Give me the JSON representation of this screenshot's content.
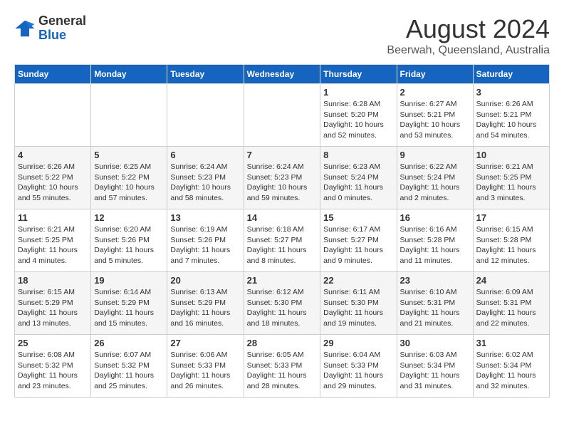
{
  "logo": {
    "general": "General",
    "blue": "Blue"
  },
  "title": "August 2024",
  "subtitle": "Beerwah, Queensland, Australia",
  "days_of_week": [
    "Sunday",
    "Monday",
    "Tuesday",
    "Wednesday",
    "Thursday",
    "Friday",
    "Saturday"
  ],
  "weeks": [
    [
      {
        "day": "",
        "info": ""
      },
      {
        "day": "",
        "info": ""
      },
      {
        "day": "",
        "info": ""
      },
      {
        "day": "",
        "info": ""
      },
      {
        "day": "1",
        "info": "Sunrise: 6:28 AM\nSunset: 5:20 PM\nDaylight: 10 hours and 52 minutes."
      },
      {
        "day": "2",
        "info": "Sunrise: 6:27 AM\nSunset: 5:21 PM\nDaylight: 10 hours and 53 minutes."
      },
      {
        "day": "3",
        "info": "Sunrise: 6:26 AM\nSunset: 5:21 PM\nDaylight: 10 hours and 54 minutes."
      }
    ],
    [
      {
        "day": "4",
        "info": "Sunrise: 6:26 AM\nSunset: 5:22 PM\nDaylight: 10 hours and 55 minutes."
      },
      {
        "day": "5",
        "info": "Sunrise: 6:25 AM\nSunset: 5:22 PM\nDaylight: 10 hours and 57 minutes."
      },
      {
        "day": "6",
        "info": "Sunrise: 6:24 AM\nSunset: 5:23 PM\nDaylight: 10 hours and 58 minutes."
      },
      {
        "day": "7",
        "info": "Sunrise: 6:24 AM\nSunset: 5:23 PM\nDaylight: 10 hours and 59 minutes."
      },
      {
        "day": "8",
        "info": "Sunrise: 6:23 AM\nSunset: 5:24 PM\nDaylight: 11 hours and 0 minutes."
      },
      {
        "day": "9",
        "info": "Sunrise: 6:22 AM\nSunset: 5:24 PM\nDaylight: 11 hours and 2 minutes."
      },
      {
        "day": "10",
        "info": "Sunrise: 6:21 AM\nSunset: 5:25 PM\nDaylight: 11 hours and 3 minutes."
      }
    ],
    [
      {
        "day": "11",
        "info": "Sunrise: 6:21 AM\nSunset: 5:25 PM\nDaylight: 11 hours and 4 minutes."
      },
      {
        "day": "12",
        "info": "Sunrise: 6:20 AM\nSunset: 5:26 PM\nDaylight: 11 hours and 5 minutes."
      },
      {
        "day": "13",
        "info": "Sunrise: 6:19 AM\nSunset: 5:26 PM\nDaylight: 11 hours and 7 minutes."
      },
      {
        "day": "14",
        "info": "Sunrise: 6:18 AM\nSunset: 5:27 PM\nDaylight: 11 hours and 8 minutes."
      },
      {
        "day": "15",
        "info": "Sunrise: 6:17 AM\nSunset: 5:27 PM\nDaylight: 11 hours and 9 minutes."
      },
      {
        "day": "16",
        "info": "Sunrise: 6:16 AM\nSunset: 5:28 PM\nDaylight: 11 hours and 11 minutes."
      },
      {
        "day": "17",
        "info": "Sunrise: 6:15 AM\nSunset: 5:28 PM\nDaylight: 11 hours and 12 minutes."
      }
    ],
    [
      {
        "day": "18",
        "info": "Sunrise: 6:15 AM\nSunset: 5:29 PM\nDaylight: 11 hours and 13 minutes."
      },
      {
        "day": "19",
        "info": "Sunrise: 6:14 AM\nSunset: 5:29 PM\nDaylight: 11 hours and 15 minutes."
      },
      {
        "day": "20",
        "info": "Sunrise: 6:13 AM\nSunset: 5:29 PM\nDaylight: 11 hours and 16 minutes."
      },
      {
        "day": "21",
        "info": "Sunrise: 6:12 AM\nSunset: 5:30 PM\nDaylight: 11 hours and 18 minutes."
      },
      {
        "day": "22",
        "info": "Sunrise: 6:11 AM\nSunset: 5:30 PM\nDaylight: 11 hours and 19 minutes."
      },
      {
        "day": "23",
        "info": "Sunrise: 6:10 AM\nSunset: 5:31 PM\nDaylight: 11 hours and 21 minutes."
      },
      {
        "day": "24",
        "info": "Sunrise: 6:09 AM\nSunset: 5:31 PM\nDaylight: 11 hours and 22 minutes."
      }
    ],
    [
      {
        "day": "25",
        "info": "Sunrise: 6:08 AM\nSunset: 5:32 PM\nDaylight: 11 hours and 23 minutes."
      },
      {
        "day": "26",
        "info": "Sunrise: 6:07 AM\nSunset: 5:32 PM\nDaylight: 11 hours and 25 minutes."
      },
      {
        "day": "27",
        "info": "Sunrise: 6:06 AM\nSunset: 5:33 PM\nDaylight: 11 hours and 26 minutes."
      },
      {
        "day": "28",
        "info": "Sunrise: 6:05 AM\nSunset: 5:33 PM\nDaylight: 11 hours and 28 minutes."
      },
      {
        "day": "29",
        "info": "Sunrise: 6:04 AM\nSunset: 5:33 PM\nDaylight: 11 hours and 29 minutes."
      },
      {
        "day": "30",
        "info": "Sunrise: 6:03 AM\nSunset: 5:34 PM\nDaylight: 11 hours and 31 minutes."
      },
      {
        "day": "31",
        "info": "Sunrise: 6:02 AM\nSunset: 5:34 PM\nDaylight: 11 hours and 32 minutes."
      }
    ]
  ]
}
